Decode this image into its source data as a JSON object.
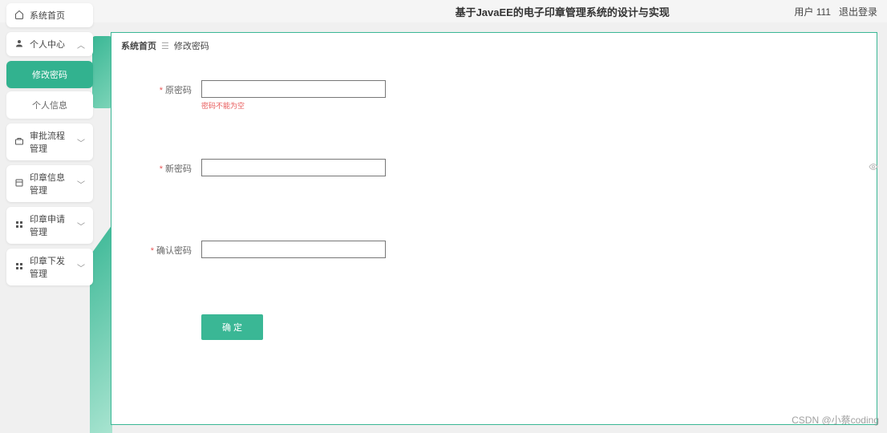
{
  "header": {
    "title": "基于JavaEE的电子印章管理系统的设计与实现",
    "user_label": "用户 111",
    "logout_label": "退出登录"
  },
  "sidebar": {
    "home": {
      "label": "系统首页",
      "icon": "home-icon"
    },
    "personal": {
      "label": "个人中心",
      "icon": "user-icon",
      "expanded": true,
      "children": [
        {
          "label": "修改密码",
          "active": true
        },
        {
          "label": "个人信息",
          "active": false
        }
      ]
    },
    "menus": [
      {
        "label": "审批流程管理",
        "icon": "briefcase-icon"
      },
      {
        "label": "印章信息管理",
        "icon": "archive-icon"
      },
      {
        "label": "印章申请管理",
        "icon": "grid-icon"
      },
      {
        "label": "印章下发管理",
        "icon": "grid-icon"
      }
    ]
  },
  "breadcrumb": {
    "root": "系统首页",
    "current": "修改密码"
  },
  "form": {
    "old_password": {
      "label": "原密码",
      "value": "",
      "error": "密码不能为空"
    },
    "new_password": {
      "label": "新密码",
      "value": ""
    },
    "confirm_password": {
      "label": "确认密码",
      "value": ""
    },
    "submit_label": "确 定"
  },
  "watermark": "CSDN @小蔡coding"
}
